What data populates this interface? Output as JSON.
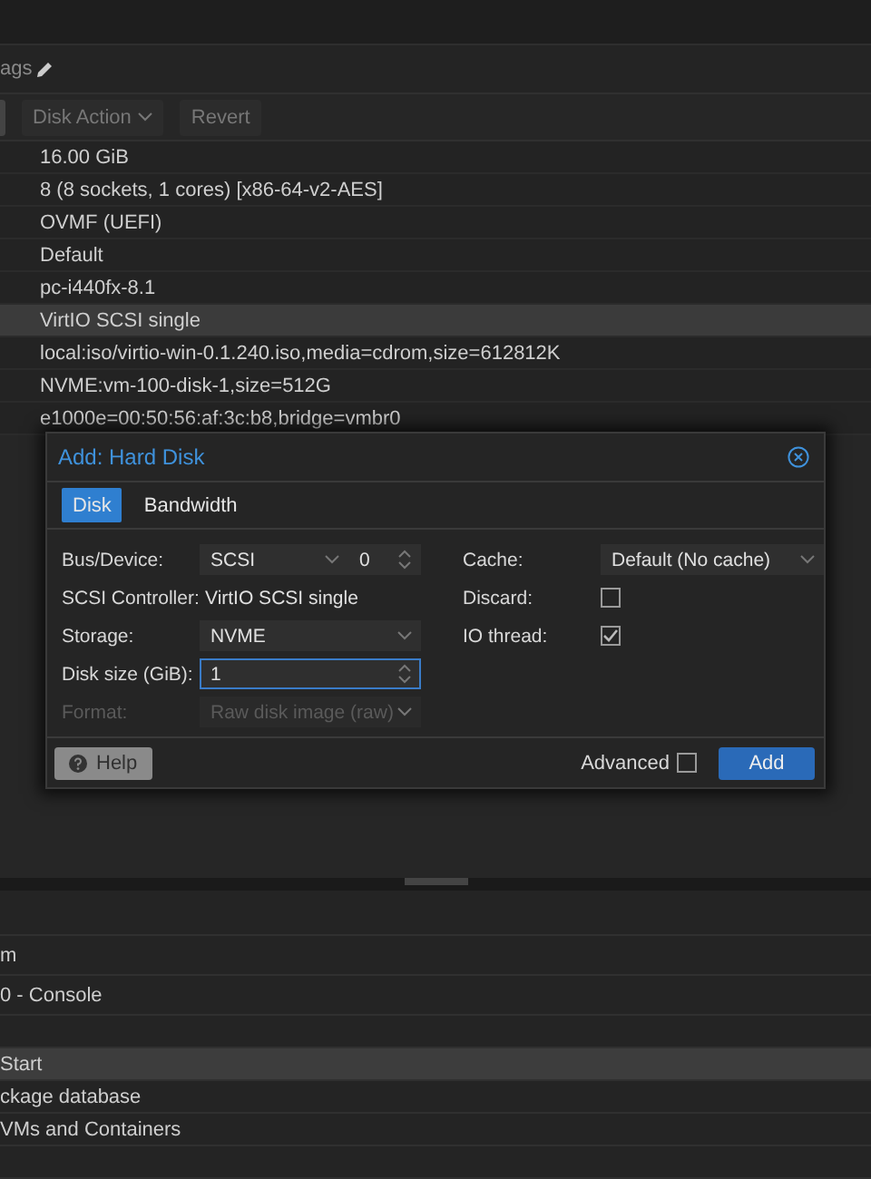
{
  "header": {
    "tags_label": "ags"
  },
  "toolbar": {
    "buttons": [
      {
        "label": "Disk Action",
        "menu": true
      },
      {
        "label": "Revert",
        "menu": false
      }
    ]
  },
  "hardware_rows": [
    {
      "value": "16.00 GiB",
      "selected": false
    },
    {
      "value": "8 (8 sockets, 1 cores) [x86-64-v2-AES]",
      "selected": false
    },
    {
      "value": "OVMF (UEFI)",
      "selected": false
    },
    {
      "value": "Default",
      "selected": false
    },
    {
      "value": "pc-i440fx-8.1",
      "selected": false
    },
    {
      "value": "VirtIO SCSI single",
      "selected": true
    },
    {
      "value": "local:iso/virtio-win-0.1.240.iso,media=cdrom,size=612812K",
      "selected": false
    },
    {
      "value": "NVME:vm-100-disk-1,size=512G",
      "selected": false
    },
    {
      "value": "e1000e=00:50:56:af:3c:b8,bridge=vmbr0",
      "selected": false
    }
  ],
  "task_rows": [
    {
      "text": "",
      "selected": false
    },
    {
      "text": "m",
      "selected": false
    },
    {
      "text": "0 - Console",
      "selected": false
    },
    {
      "text": "",
      "selected": false
    },
    {
      "text": "Start",
      "selected": true
    },
    {
      "text": "ckage database",
      "selected": false
    },
    {
      "text": "VMs and Containers",
      "selected": false
    },
    {
      "text": "",
      "selected": false
    }
  ],
  "dialog": {
    "title": "Add: Hard Disk",
    "tabs": [
      {
        "label": "Disk",
        "selected": true
      },
      {
        "label": "Bandwidth",
        "selected": false
      }
    ],
    "left_fields": [
      {
        "label": "Bus/Device:",
        "kind": "combo-spin",
        "value": "SCSI",
        "number": "0",
        "disabled": false,
        "focused": false
      },
      {
        "label": "SCSI Controller:",
        "kind": "text",
        "value": "VirtIO SCSI single",
        "disabled": false,
        "focused": false
      },
      {
        "label": "Storage:",
        "kind": "select",
        "value": "NVME",
        "disabled": false,
        "focused": false
      },
      {
        "label": "Disk size (GiB):",
        "kind": "spin",
        "value": "1",
        "disabled": false,
        "focused": true
      },
      {
        "label": "Format:",
        "kind": "select",
        "value": "Raw disk image (raw)",
        "disabled": true,
        "focused": false
      }
    ],
    "right_fields": [
      {
        "label": "Cache:",
        "kind": "select",
        "value": "Default (No cache)"
      },
      {
        "label": "Discard:",
        "kind": "checkbox",
        "checked": false
      },
      {
        "label": "IO thread:",
        "kind": "checkbox",
        "checked": true
      }
    ],
    "help_button": "Help",
    "advanced": {
      "label": "Advanced",
      "checked": false
    },
    "add_button": "Add"
  }
}
